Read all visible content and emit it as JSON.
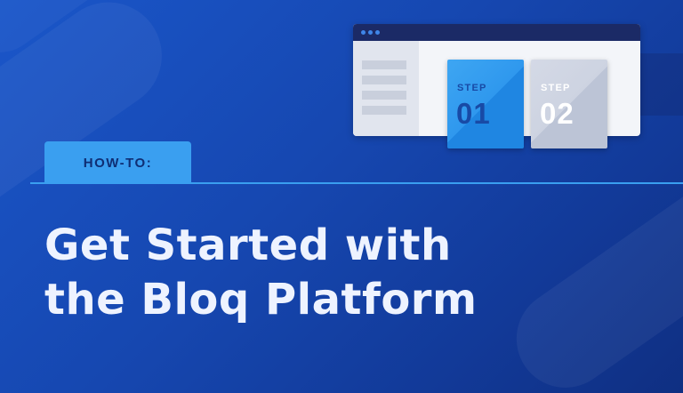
{
  "colors": {
    "background": "#1647b0",
    "accent": "#3a9ff0",
    "window_bar": "#1b2a66",
    "step1_card": "#2f98ee",
    "step2_card": "#cdd3e1"
  },
  "illustration": {
    "step1": {
      "label": "STEP",
      "number": "01"
    },
    "step2": {
      "label": "STEP",
      "number": "02"
    }
  },
  "tag": {
    "label": "HOW-TO:"
  },
  "headline": {
    "line1": "Get Started with",
    "line2": "the Bloq Platform"
  }
}
